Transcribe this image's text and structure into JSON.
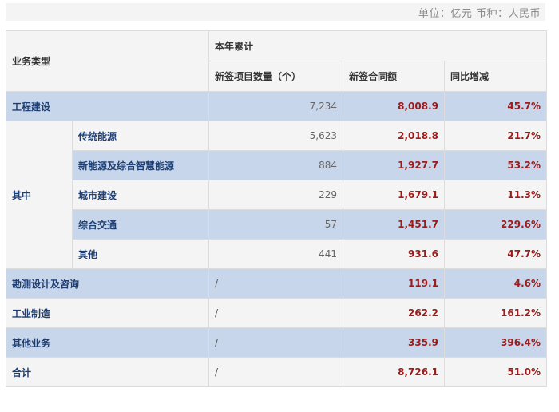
{
  "unit_note": "单位：亿元 币种：人民币",
  "header": {
    "business_type": "业务类型",
    "ytd": "本年累计",
    "count": "新签项目数量（个）",
    "amount": "新签合同额",
    "yoy": "同比增减"
  },
  "rows": [
    {
      "label": "工程建设",
      "count": "7,234",
      "amount": "8,008.9",
      "yoy": "45.7%"
    },
    {
      "label": "传统能源",
      "count": "5,623",
      "amount": "2,018.8",
      "yoy": "21.7%"
    },
    {
      "label": "新能源及综合智慧能源",
      "count": "884",
      "amount": "1,927.7",
      "yoy": "53.2%"
    },
    {
      "label": "城市建设",
      "count": "229",
      "amount": "1,679.1",
      "yoy": "11.3%"
    },
    {
      "label": "综合交通",
      "count": "57",
      "amount": "1,451.7",
      "yoy": "229.6%"
    },
    {
      "label": "其他",
      "count": "441",
      "amount": "931.6",
      "yoy": "47.7%"
    },
    {
      "label": "勘测设计及咨询",
      "count": "/",
      "amount": "119.1",
      "yoy": "4.6%"
    },
    {
      "label": "工业制造",
      "count": "/",
      "amount": "262.2",
      "yoy": "161.2%"
    },
    {
      "label": "其他业务",
      "count": "/",
      "amount": "335.9",
      "yoy": "396.4%"
    },
    {
      "label": "合计",
      "count": "/",
      "amount": "8,726.1",
      "yoy": "51.0%"
    }
  ],
  "qizhong_label": "其中"
}
